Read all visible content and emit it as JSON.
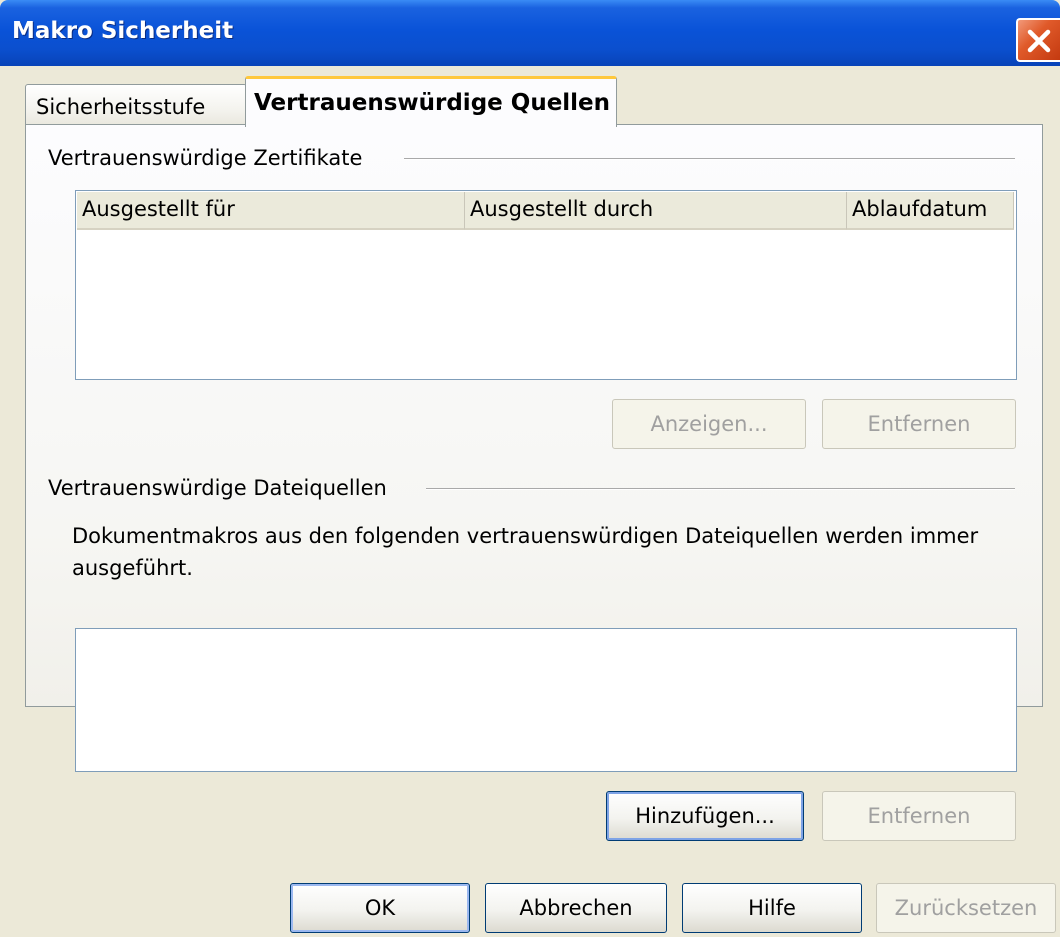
{
  "window": {
    "title": "Makro Sicherheit"
  },
  "tabs": [
    {
      "label": "Sicherheitsstufe",
      "active": false
    },
    {
      "label": "Vertrauenswürdige Quellen",
      "active": true
    }
  ],
  "certificates": {
    "group_title": "Vertrauenswürdige Zertifikate",
    "columns": [
      "Ausgestellt für",
      "Ausgestellt durch",
      "Ablaufdatum"
    ],
    "rows": [],
    "buttons": {
      "view": "Anzeigen...",
      "remove": "Entfernen"
    }
  },
  "file_sources": {
    "group_title": "Vertrauenswürdige Dateiquellen",
    "description": "Dokumentmakros aus den folgenden vertrauenswürdigen Dateiquellen werden immer ausgeführt.",
    "items": [],
    "buttons": {
      "add": "Hinzufügen...",
      "remove": "Entfernen"
    }
  },
  "footer": {
    "ok": "OK",
    "cancel": "Abbrechen",
    "help": "Hilfe",
    "reset": "Zurücksetzen"
  },
  "colors": {
    "titlebar": "#0b4fce",
    "active_tab_accent": "#ffc83c",
    "close_button": "#e05a2a",
    "dialog_bg": "#ece9d8"
  }
}
